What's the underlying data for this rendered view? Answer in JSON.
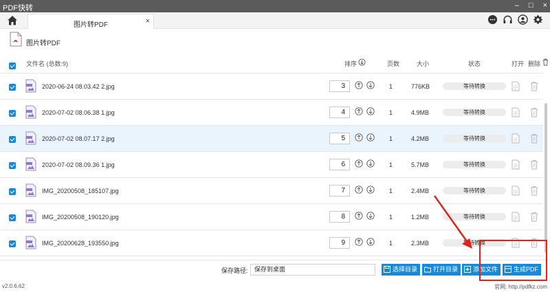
{
  "window": {
    "title": "PDF快转"
  },
  "tabs": [
    {
      "label": "图片转PDF",
      "close": "×"
    }
  ],
  "page": {
    "title": "图片转PDF"
  },
  "table": {
    "headers": {
      "filename": "文件名 (总数:9)",
      "order": "排序",
      "pages": "页数",
      "size": "大小",
      "status": "状态",
      "open": "打开",
      "delete": "删除"
    },
    "rows": [
      {
        "name": "2020-06-24 08.03.42 2.jpg",
        "order": "3",
        "pages": "1",
        "size": "776KB",
        "status": "等待转换",
        "selected": false
      },
      {
        "name": "2020-07-02 08.06.38 1.jpg",
        "order": "4",
        "pages": "1",
        "size": "4.9MB",
        "status": "等待转换",
        "selected": false
      },
      {
        "name": "2020-07-02 08.07.17 2.jpg",
        "order": "5",
        "pages": "1",
        "size": "4.2MB",
        "status": "等待转换",
        "selected": true
      },
      {
        "name": "2020-07-02 08.09.36 1.jpg",
        "order": "6",
        "pages": "1",
        "size": "5.7MB",
        "status": "等待转换",
        "selected": false
      },
      {
        "name": "IMG_20200508_185107.jpg",
        "order": "7",
        "pages": "1",
        "size": "2.4MB",
        "status": "等待转换",
        "selected": false
      },
      {
        "name": "IMG_20200508_190120.jpg",
        "order": "8",
        "pages": "1",
        "size": "1.2MB",
        "status": "等待转换",
        "selected": false
      },
      {
        "name": "IMG_20200628_193550.jpg",
        "order": "9",
        "pages": "1",
        "size": "2.3MB",
        "status": "等待转换",
        "selected": false
      }
    ]
  },
  "bottom": {
    "save_label": "保存路径:",
    "save_value": "保存到桌面",
    "buttons": {
      "choose_dir": "选择目录",
      "open_dir": "打开目录",
      "add_file": "添加文件",
      "generate": "生成PDF"
    }
  },
  "footer": {
    "version": "v2.0.6.62",
    "website": "官网: http://pdfkz.com"
  },
  "colors": {
    "accent": "#1689d8",
    "highlight_box": "#e0221b",
    "titlebar": "#5b5b5b",
    "selected_row": "#eaf4fd"
  },
  "icons": [
    "home-icon",
    "chat-icon",
    "headset-icon",
    "user-icon",
    "gear-icon",
    "pdf-file-icon",
    "image-file-icon",
    "arrow-up-icon",
    "arrow-down-icon",
    "open-file-icon",
    "trash-icon",
    "sort-icon",
    "folder-icon",
    "add-icon"
  ]
}
